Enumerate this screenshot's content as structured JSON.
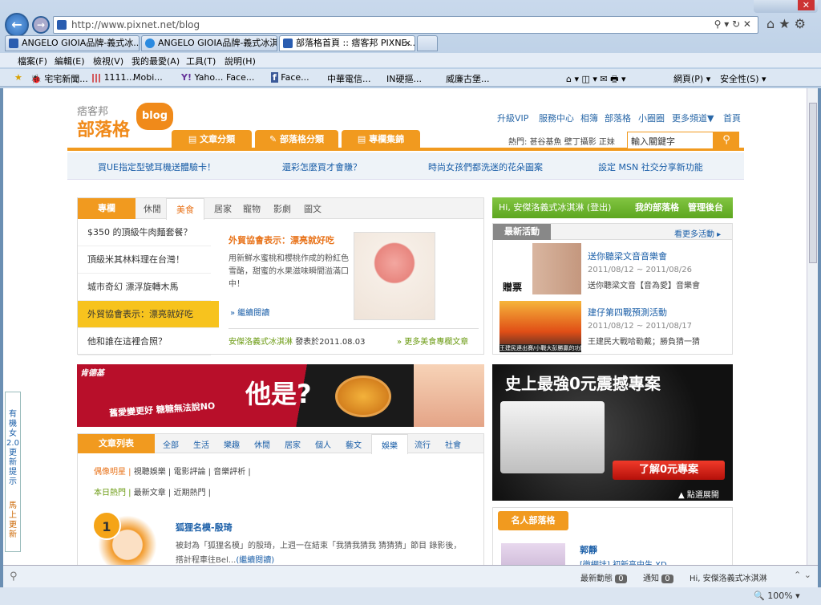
{
  "browser": {
    "address": "http://www.pixnet.net/blog",
    "tabs": [
      "ANGELO GIOIA品牌-義式冰...",
      "ANGELO GIOIA品牌-義式冰淇...",
      "部落格首頁 :: 痞客邦 PIXNE..."
    ],
    "tab_close": "×",
    "menu": [
      "檔案(F)",
      "編輯(E)",
      "檢視(V)",
      "我的最愛(A)",
      "工具(T)",
      "說明(H)"
    ],
    "favorites": [
      "宅宅新聞...",
      "1111...",
      "Mobi...",
      "Yaho...",
      "Face...",
      "Face...",
      "中華電信...",
      "IN硬摳...",
      "威廉古堡..."
    ],
    "toolbar_right": [
      "網頁(P) ▾",
      "安全性(S) ▾"
    ],
    "zoom": "100%"
  },
  "site": {
    "logo_top": "痞客邦",
    "logo_main": "部落格",
    "logo_badge": "blog",
    "toplinks": [
      "升級VIP",
      "服務中心",
      "相簿",
      "部落格",
      "小圈圈",
      "更多頻道▼",
      "首頁"
    ],
    "nav_tabs": [
      "文章分類",
      "部落格分類",
      "專欄集錦"
    ],
    "hot_label": "熱門:",
    "hot_words": "甚谷基魚 壁丁攝影 正妹",
    "search_placeholder": "輸入關鍵字",
    "promo": [
      "買UE指定型號耳機送體驗卡！",
      "還彩怎麼買才會賺？",
      "時尚女孩們都洗迷的花朵圖案",
      "設定 MSN 社交分享新功能"
    ]
  },
  "column": {
    "label": "專欄",
    "tabs": [
      "休閒",
      "美食",
      "居家",
      "寵物",
      "影劇",
      "圖文"
    ],
    "list": [
      "$350 的頂級牛肉麵套餐？",
      "頂級米其林料理在台灣！",
      "城市奇幻 漂浮旋轉木馬",
      "外貿協會表示：漂亮就好吃",
      "他和誰在這裡合照？"
    ],
    "feature_title": "外貿協會表示：漂亮就好吃",
    "feature_text": "用新鮮水蜜桃和櫻桃作成的粉紅色雪酪，甜蜜的水果滋味瞬間溢滿口中！",
    "read_more": "» 繼續閱讀",
    "author": "安傑洛義式冰淇淋",
    "posted": "發表於2011.08.03",
    "more_link": "» 更多美食專欄文章"
  },
  "ad_kfc": {
    "brand": "肯德基",
    "slogan": "舊愛變更好 糖糖無法說NO",
    "big": "他是?"
  },
  "articles": {
    "label": "文章列表",
    "tabs": [
      "全部",
      "生活",
      "樂趣",
      "休閒",
      "居家",
      "個人",
      "藝文",
      "娛樂",
      "流行",
      "社會"
    ],
    "subcats": [
      "偶像明星 |",
      "視聽娛樂 |",
      "電影評論 |",
      "音樂評析 |"
    ],
    "subtabs": [
      "本日熱門 |",
      "最新文章 |",
      "近期熱門 |"
    ],
    "rank": "1",
    "item_title": "狐狸名模-殷琦",
    "item_text": "被封為「狐狸名模」的殷琦，上週一在結束「我猜我猜我 猜猜猜」節目 錄影後，",
    "item_text2": "搭計程車往Bel...",
    "item_more": "(繼續閱讀)"
  },
  "right": {
    "greet": "Hi, 安傑洛義式冰淇淋 (登出)",
    "my_blog": "我的部落格",
    "admin": "管理後台",
    "events_label": "最新活動",
    "more_events": "看更多活動 ▸",
    "events": [
      {
        "title": "送你聽梁文音音樂會",
        "date": "2011/08/12 ~ 2011/08/26",
        "desc": "送你聽梁文音【音為愛】音樂會",
        "tag": "贈票"
      },
      {
        "title": "建仔第四戰預測活動",
        "date": "2011/08/12 ~ 2011/08/17",
        "desc": "王建民大戰哈勒戴；勝負猜一猜",
        "tag": "王建民連出賽/小戰大彭勝贏的功能"
      }
    ],
    "ad_title": "史上最強0元震撼專案",
    "ad_button": "了解0元專案",
    "ad_more": "▲ 點選展開",
    "celeb_label": "名人部落格",
    "celeb_name": "郭靜",
    "celeb_sub": "[微網誌] 初新高中生 XD"
  },
  "side_float": {
    "title": "有機女2.0 更新提示",
    "cta": "馬上更新"
  },
  "statusbar": {
    "news": "最新動態",
    "news_count": "0",
    "notice": "通知",
    "notice_count": "0",
    "user": "Hi, 安傑洛義式冰淇淋"
  }
}
